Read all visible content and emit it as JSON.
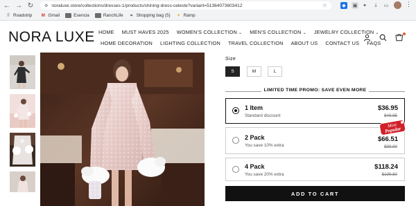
{
  "browser": {
    "url": "noraluxe.store/collections/dresses-1/products/shining-dress-celeste?variant=51364073603412",
    "bookmarks": [
      {
        "label": "Roadstrip",
        "icon": "grid-icon"
      },
      {
        "label": "Gmail",
        "icon": "gmail-icon"
      },
      {
        "label": "Esencia",
        "icon": "folder-icon"
      },
      {
        "label": "RanchLife",
        "icon": "folder-icon"
      },
      {
        "label": "Shopping bag (5)",
        "icon": "shopping-bag-icon"
      },
      {
        "label": "Ramp",
        "icon": "ramp-icon"
      }
    ]
  },
  "site": {
    "logo": "NORA LUXE",
    "nav_row1": [
      {
        "label": "HOME",
        "has_dropdown": false
      },
      {
        "label": "MUST HAVES 2025",
        "has_dropdown": false
      },
      {
        "label": "WOMEN'S COLLECTION",
        "has_dropdown": true
      },
      {
        "label": "MEN'S COLLECTION",
        "has_dropdown": true
      },
      {
        "label": "JEWELRY COLLECTION",
        "has_dropdown": true
      }
    ],
    "nav_row2": [
      {
        "label": "HOME DECORATION"
      },
      {
        "label": "LIGHTING COLLECTION"
      },
      {
        "label": "TRAVEL COLLECTION"
      },
      {
        "label": "ABOUT US"
      },
      {
        "label": "CONTACT US"
      },
      {
        "label": "FAQS"
      }
    ],
    "chevron": "⌄"
  },
  "product": {
    "size_label": "Size",
    "sizes": [
      {
        "label": "S",
        "selected": true
      },
      {
        "label": "M",
        "selected": false
      },
      {
        "label": "L",
        "selected": false
      }
    ],
    "promo": "LIMITED TIME PROMO: SAVE EVEN MORE",
    "bundles": [
      {
        "title": "1 Item",
        "subtitle": "Standard discount",
        "price": "$36.95",
        "old_price": "$49.95",
        "selected": true
      },
      {
        "title": "2 Pack",
        "subtitle": "You save 10% extra",
        "price": "$66.51",
        "old_price": "$99.90",
        "selected": false
      },
      {
        "title": "4 Pack",
        "subtitle": "You save 20% extra",
        "price": "$118.24",
        "old_price": "$199.80",
        "selected": false
      }
    ],
    "badge_line1": "Most",
    "badge_line2": "Popular",
    "add_to_cart": "ADD TO CART"
  },
  "colors": {
    "accent": "#111111",
    "badge_red": "#d0202a",
    "cart_dot": "#e55b2b"
  }
}
